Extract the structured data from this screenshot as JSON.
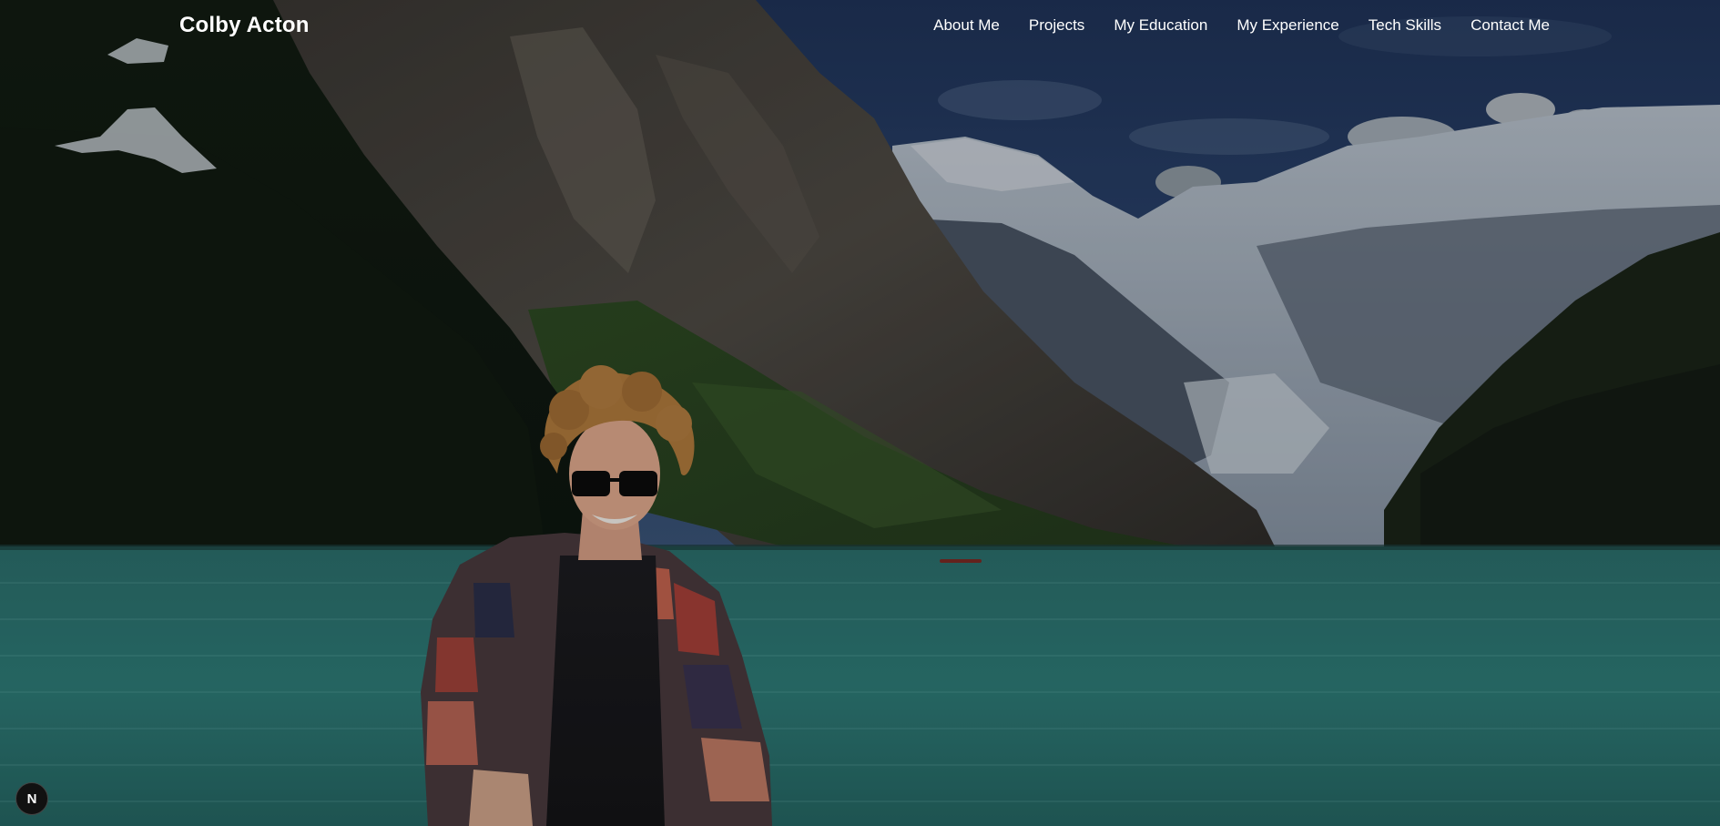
{
  "site": {
    "brand": "Colby Acton"
  },
  "nav": {
    "items": [
      {
        "label": "About Me"
      },
      {
        "label": "Projects"
      },
      {
        "label": "My Education"
      },
      {
        "label": "My Experience"
      },
      {
        "label": "Tech Skills"
      },
      {
        "label": "Contact Me"
      }
    ]
  },
  "hero": {
    "image_icon": "mountain-lake-portrait-photo"
  },
  "dev_badge": {
    "label": "N",
    "icon": "nextjs-dev-indicator-icon"
  },
  "colors": {
    "nav_text": "#ffffff",
    "lake": "#2f7a76",
    "sky": "#2a3f66"
  }
}
